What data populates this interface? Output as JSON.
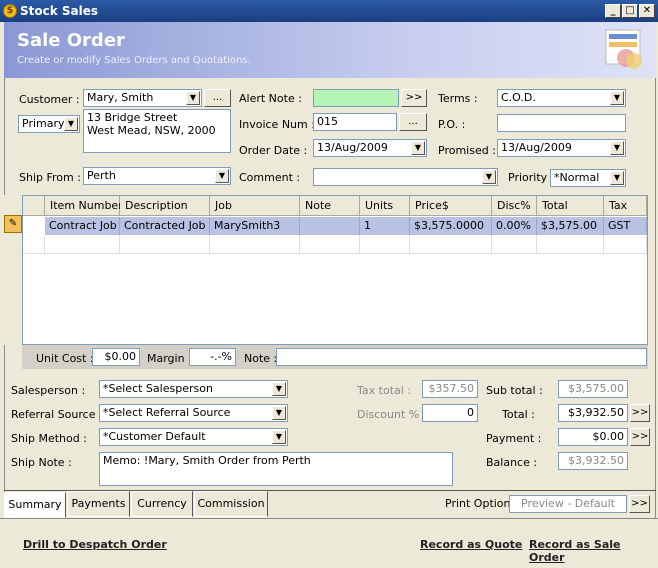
{
  "window": {
    "title": "Stock Sales"
  },
  "banner": {
    "title": "Sale Order",
    "subtitle": "Create or modify Sales Orders and Quotations."
  },
  "customer": {
    "label": "Customer :",
    "value": "Mary, Smith",
    "address_type": "Primary",
    "address": [
      "13 Bridge Street",
      "West Mead, NSW, 2000"
    ]
  },
  "ship_from": {
    "label": "Ship From :",
    "value": "Perth"
  },
  "alert_note": {
    "label": "Alert Note :",
    "value": ""
  },
  "invoice_num": {
    "label": "Invoice Num :",
    "value": "015"
  },
  "order_date": {
    "label": "Order Date :",
    "value": "13/Aug/2009"
  },
  "comment": {
    "label": "Comment :",
    "value": ""
  },
  "terms": {
    "label": "Terms :",
    "value": "C.O.D."
  },
  "po": {
    "label": "P.O. :",
    "value": ""
  },
  "promised": {
    "label": "Promised :",
    "value": "13/Aug/2009"
  },
  "priority": {
    "label": "Priority :",
    "value": "*Normal"
  },
  "buttons": {
    "ellipsis": "...",
    "more": ">>"
  },
  "grid": {
    "columns": [
      "Item Number",
      "Description",
      "Job",
      "Note",
      "Units",
      "Price$",
      "Disc%",
      "Total",
      "Tax"
    ],
    "rows": [
      [
        "Contract Job",
        "Contracted Job",
        "MarySmith3",
        "",
        "1",
        "$3,575.0000",
        "0.00%",
        "$3,575.00",
        "GST"
      ]
    ]
  },
  "costbar": {
    "unit_cost_label": "Unit Cost :",
    "unit_cost": "$0.00",
    "margin_label": "Margin :",
    "margin": "-.-%",
    "note_label": "Note :",
    "note": ""
  },
  "salesperson": {
    "label": "Salesperson :",
    "value": "*Select Salesperson"
  },
  "referral": {
    "label": "Referral Source :",
    "value": "*Select Referral Source"
  },
  "ship_method": {
    "label": "Ship Method :",
    "value": "*Customer Default"
  },
  "ship_note": {
    "label": "Ship Note :",
    "value": "Memo: !Mary, Smith Order from Perth"
  },
  "totals": {
    "tax_total_label": "Tax total :",
    "tax_total": "$357.50",
    "discount_label": "Discount % :",
    "discount": "0",
    "sub_total_label": "Sub total :",
    "sub_total": "$3,575.00",
    "total_label": "Total :",
    "total": "$3,932.50",
    "payment_label": "Payment :",
    "payment": "$0.00",
    "balance_label": "Balance :",
    "balance": "$3,932.50"
  },
  "tabs": [
    "Summary",
    "Payments",
    "Currency",
    "Commission"
  ],
  "print": {
    "label": "Print Option :",
    "value": "Preview - Default"
  },
  "links": {
    "drill": "Drill to Despatch Order",
    "quote": "Record as Quote",
    "sale": "Record as Sale Order"
  }
}
